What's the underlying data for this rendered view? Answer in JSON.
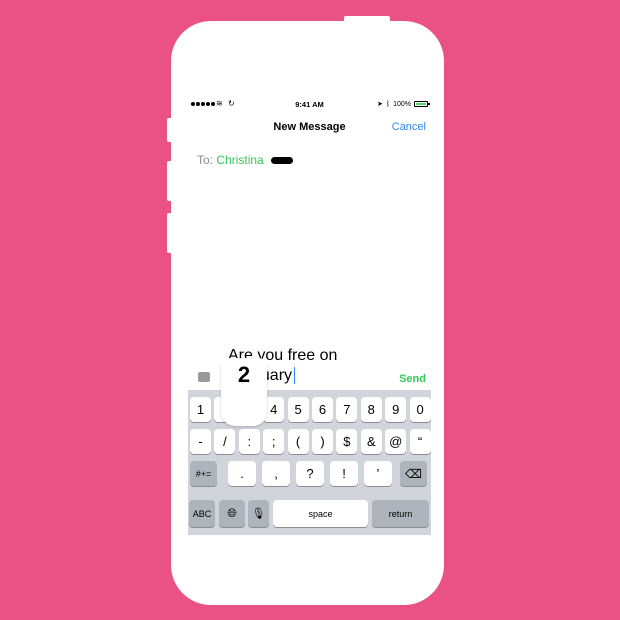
{
  "status": {
    "time": "9:41 AM",
    "battery": "100%"
  },
  "nav": {
    "title": "New Message",
    "cancel": "Cancel"
  },
  "recipient": {
    "label": "To:",
    "name": "Christina"
  },
  "message": {
    "line1": "Are you free on",
    "line2": "February"
  },
  "send": "Send",
  "popup_key": "2",
  "keyboard": {
    "row1": [
      "1",
      "2",
      "3",
      "4",
      "5",
      "6",
      "7",
      "8",
      "9",
      "0"
    ],
    "row2": [
      "-",
      "/",
      ":",
      ";",
      "(",
      ")",
      "$",
      "&",
      "@",
      "“"
    ],
    "row3": [
      ".",
      ",",
      "?",
      "!",
      "’"
    ],
    "row3_left": "#+=",
    "abc": "ABC",
    "space": "space",
    "return": "return"
  },
  "colors": {
    "background": "#ea5286",
    "accent_blue": "#2f86f6",
    "accent_green": "#34c759"
  }
}
